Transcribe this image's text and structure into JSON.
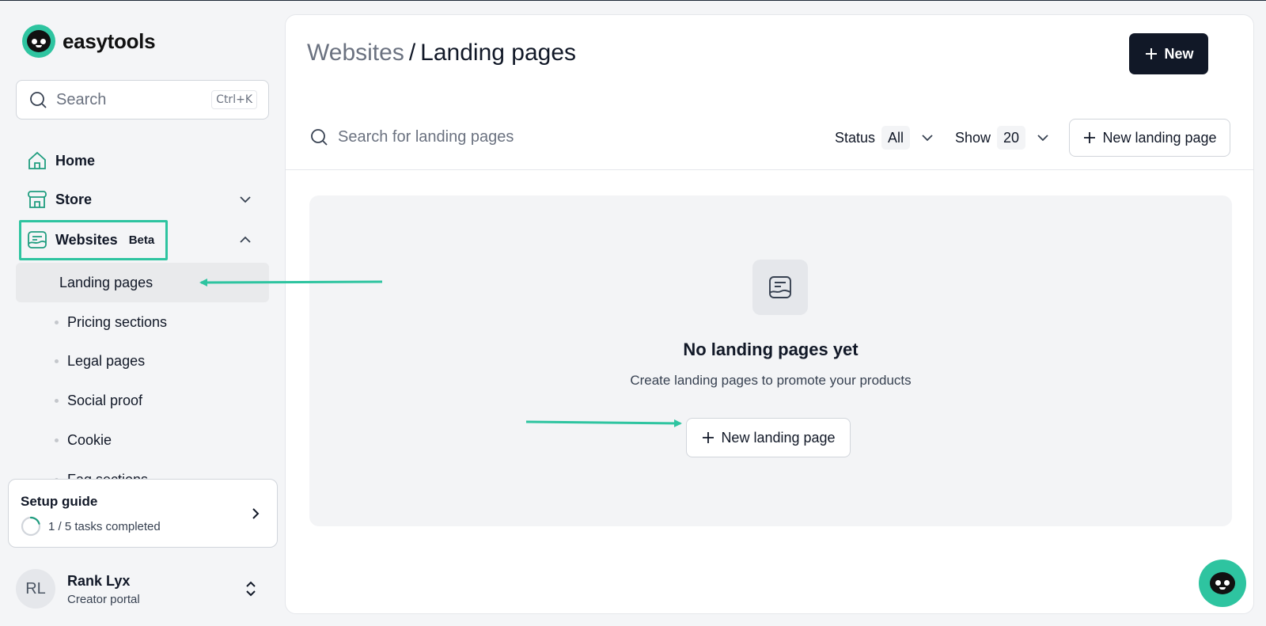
{
  "brand": {
    "name": "easytools",
    "accent": "#2ec4a0"
  },
  "sidebar": {
    "search_placeholder": "Search",
    "search_shortcut": "Ctrl+K",
    "items": [
      {
        "label": "Home",
        "icon": "home-icon"
      },
      {
        "label": "Store",
        "icon": "store-icon"
      },
      {
        "label": "Websites",
        "icon": "websites-icon",
        "badge": "Beta"
      }
    ],
    "websites_sub": [
      {
        "label": "Landing pages",
        "active": true
      },
      {
        "label": "Pricing sections"
      },
      {
        "label": "Legal pages"
      },
      {
        "label": "Social proof"
      },
      {
        "label": "Cookie"
      },
      {
        "label": "Faq sections"
      }
    ]
  },
  "setup_guide": {
    "title": "Setup guide",
    "progress_text": "1 / 5 tasks completed",
    "progress": 0.2
  },
  "user": {
    "initials": "RL",
    "name": "Rank Lyx",
    "role": "Creator portal"
  },
  "header": {
    "crumb_parent": "Websites",
    "crumb_sep": "/",
    "crumb_current": "Landing pages",
    "new_button": "New"
  },
  "toolbar": {
    "search_placeholder": "Search for landing pages",
    "status_label": "Status",
    "status_value": "All",
    "show_label": "Show",
    "show_value": "20",
    "new_landing_button": "New landing page"
  },
  "empty_state": {
    "title": "No landing pages yet",
    "description": "Create landing pages to promote your products",
    "button": "New landing page"
  }
}
